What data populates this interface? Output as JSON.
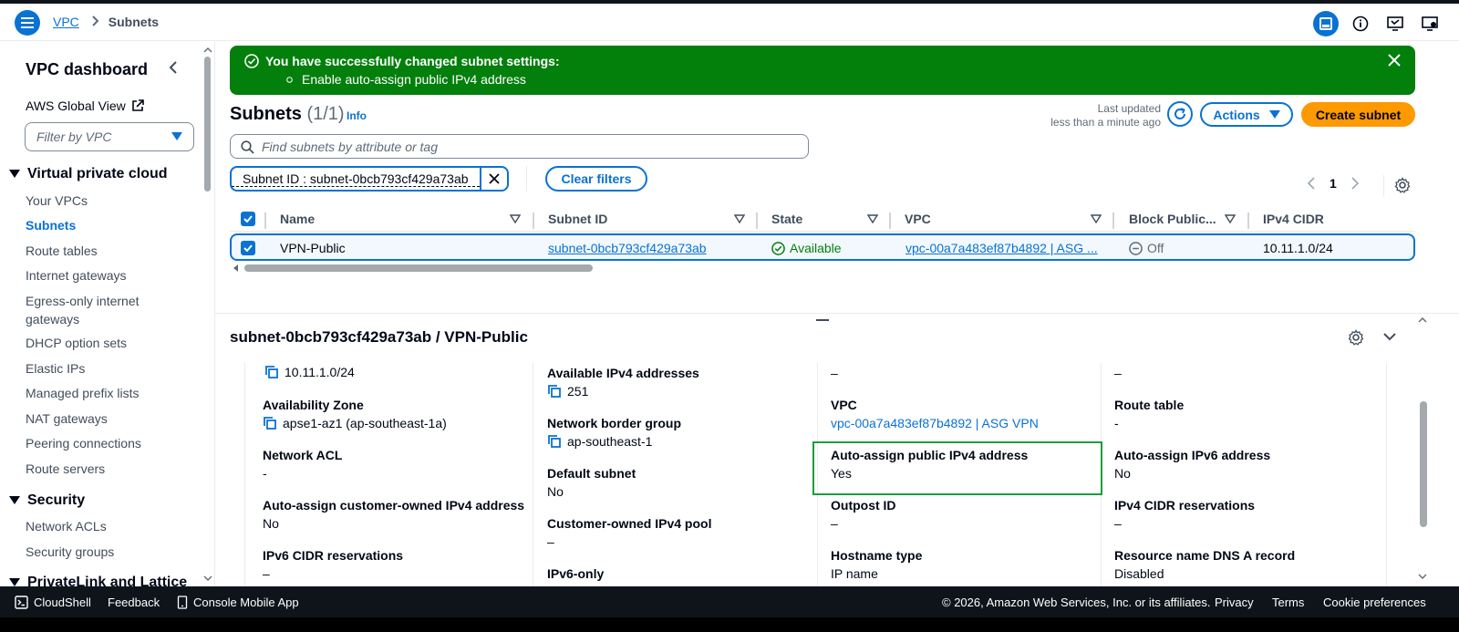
{
  "header": {
    "breadcrumb_vpc": "VPC",
    "breadcrumb_current": "Subnets"
  },
  "sidebar": {
    "title": "VPC dashboard",
    "global_view": "AWS Global View",
    "filter_placeholder": "Filter by VPC",
    "section_vpc": "Virtual private cloud",
    "items": [
      "Your VPCs",
      "Subnets",
      "Route tables",
      "Internet gateways",
      "Egress-only internet gateways",
      "DHCP option sets",
      "Elastic IPs",
      "Managed prefix lists",
      "NAT gateways",
      "Peering connections",
      "Route servers"
    ],
    "section_security": "Security",
    "security_items": [
      "Network ACLs",
      "Security groups"
    ],
    "section_privatelink": "PrivateLink and Lattice"
  },
  "flash": {
    "title": "You have successfully changed subnet settings:",
    "item": "Enable auto-assign public IPv4 address"
  },
  "subnets": {
    "title": "Subnets",
    "count": "(1/1)",
    "info": "Info",
    "last_updated_label": "Last updated",
    "last_updated_value": "less than a minute ago",
    "actions_label": "Actions",
    "create_label": "Create subnet",
    "search_placeholder": "Find subnets by attribute or tag",
    "filter_token": "Subnet ID : subnet-0bcb793cf429a73ab",
    "clear_filters": "Clear filters",
    "page": "1"
  },
  "table": {
    "columns": [
      "Name",
      "Subnet ID",
      "State",
      "VPC",
      "Block Public...",
      "IPv4 CIDR"
    ],
    "row": {
      "name": "VPN-Public",
      "subnet_id": "subnet-0bcb793cf429a73ab",
      "state": "Available",
      "vpc": "vpc-00a7a483ef87b4892 | ASG ...",
      "block_public": "Off",
      "ipv4_cidr": "10.11.1.0/24"
    }
  },
  "details": {
    "title": "subnet-0bcb793cf429a73ab / VPN-Public",
    "col1": {
      "cidr": "10.11.1.0/24",
      "az_label": "Availability Zone",
      "az_value": "apse1-az1 (ap-southeast-1a)",
      "acl_label": "Network ACL",
      "acl_value": "-",
      "customer_ipv4_label": "Auto-assign customer-owned IPv4 address",
      "customer_ipv4_value": "No",
      "ipv6_res_label": "IPv6 CIDR reservations",
      "ipv6_res_value": "–"
    },
    "col2": {
      "avail_label": "Available IPv4 addresses",
      "avail_value": "251",
      "border_label": "Network border group",
      "border_value": "ap-southeast-1",
      "default_label": "Default subnet",
      "default_value": "No",
      "pool_label": "Customer-owned IPv4 pool",
      "pool_value": "–",
      "ipv6only_label": "IPv6-only"
    },
    "col3": {
      "top_value": "–",
      "vpc_label": "VPC",
      "vpc_value": "vpc-00a7a483ef87b4892 | ASG VPN",
      "autoassign_label": "Auto-assign public IPv4 address",
      "autoassign_value": "Yes",
      "outpost_label": "Outpost ID",
      "outpost_value": "–",
      "hostname_label": "Hostname type",
      "hostname_value": "IP name"
    },
    "col4": {
      "top_value": "–",
      "route_label": "Route table",
      "route_value": "-",
      "ipv6_assign_label": "Auto-assign IPv6 address",
      "ipv6_assign_value": "No",
      "ipv4_res_label": "IPv4 CIDR reservations",
      "ipv4_res_value": "–",
      "dns_label": "Resource name DNS A record",
      "dns_value": "Disabled"
    }
  },
  "footer": {
    "cloudshell": "CloudShell",
    "feedback": "Feedback",
    "mobile": "Console Mobile App",
    "copyright": "© 2026, Amazon Web Services, Inc. or its affiliates.",
    "privacy": "Privacy",
    "terms": "Terms",
    "cookies": "Cookie preferences"
  },
  "colors": {
    "accent": "#0972d3",
    "success": "#037f0c",
    "primary_button": "#ff9900",
    "highlight": "#1d9e3a"
  }
}
